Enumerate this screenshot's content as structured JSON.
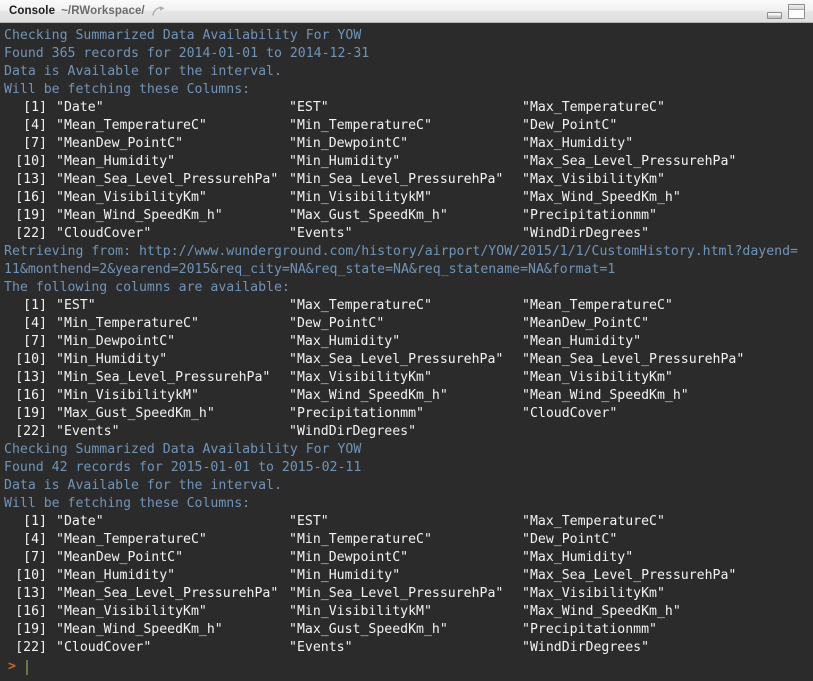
{
  "window": {
    "title": "Console",
    "path": "~/RWorkspace/",
    "icons": {
      "popout": "popout-arrow-icon",
      "minimize": "minimize-icon",
      "maximize": "maximize-icon"
    }
  },
  "colors": {
    "background": "#2b2b2b",
    "info_text": "#7094b8",
    "output_text": "#f2f2f2",
    "prompt": "#c5682a",
    "cursor": "#5f7f42",
    "titlebar": "#ededed"
  },
  "console": {
    "blocks": [
      {
        "type": "info",
        "lines": [
          "Checking Summarized Data Availability For YOW",
          "Found 365 records for 2014-01-01 to 2014-12-31",
          "Data is Available for the interval.",
          "Will be fetching these Columns:"
        ]
      },
      {
        "type": "columns",
        "rows": [
          {
            "index": "[1]",
            "cells": [
              "\"Date\"",
              "\"EST\"",
              "\"Max_TemperatureC\""
            ]
          },
          {
            "index": "[4]",
            "cells": [
              "\"Mean_TemperatureC\"",
              "\"Min_TemperatureC\"",
              "\"Dew_PointC\""
            ]
          },
          {
            "index": "[7]",
            "cells": [
              "\"MeanDew_PointC\"",
              "\"Min_DewpointC\"",
              "\"Max_Humidity\""
            ]
          },
          {
            "index": "[10]",
            "cells": [
              "\"Mean_Humidity\"",
              "\"Min_Humidity\"",
              "\"Max_Sea_Level_PressurehPa\""
            ]
          },
          {
            "index": "[13]",
            "cells": [
              "\"Mean_Sea_Level_PressurehPa\"",
              "\"Min_Sea_Level_PressurehPa\"",
              "\"Max_VisibilityKm\""
            ]
          },
          {
            "index": "[16]",
            "cells": [
              "\"Mean_VisibilityKm\"",
              "\"Min_VisibilitykM\"",
              "\"Max_Wind_SpeedKm_h\""
            ]
          },
          {
            "index": "[19]",
            "cells": [
              "\"Mean_Wind_SpeedKm_h\"",
              "\"Max_Gust_SpeedKm_h\"",
              "\"Precipitationmm\""
            ]
          },
          {
            "index": "[22]",
            "cells": [
              "\"CloudCover\"",
              "\"Events\"",
              "\"WindDirDegrees\""
            ]
          }
        ]
      },
      {
        "type": "info",
        "lines": [
          "Retrieving from: http://www.wunderground.com/history/airport/YOW/2015/1/1/CustomHistory.html?dayend=",
          "11&monthend=2&yearend=2015&req_city=NA&req_state=NA&req_statename=NA&format=1",
          "The following columns are available:"
        ]
      },
      {
        "type": "columns",
        "rows": [
          {
            "index": "[1]",
            "cells": [
              "\"EST\"",
              "\"Max_TemperatureC\"",
              "\"Mean_TemperatureC\""
            ]
          },
          {
            "index": "[4]",
            "cells": [
              "\"Min_TemperatureC\"",
              "\"Dew_PointC\"",
              "\"MeanDew_PointC\""
            ]
          },
          {
            "index": "[7]",
            "cells": [
              "\"Min_DewpointC\"",
              "\"Max_Humidity\"",
              "\"Mean_Humidity\""
            ]
          },
          {
            "index": "[10]",
            "cells": [
              "\"Min_Humidity\"",
              "\"Max_Sea_Level_PressurehPa\"",
              "\"Mean_Sea_Level_PressurehPa\""
            ]
          },
          {
            "index": "[13]",
            "cells": [
              "\"Min_Sea_Level_PressurehPa\"",
              "\"Max_VisibilityKm\"",
              "\"Mean_VisibilityKm\""
            ]
          },
          {
            "index": "[16]",
            "cells": [
              "\"Min_VisibilitykM\"",
              "\"Max_Wind_SpeedKm_h\"",
              "\"Mean_Wind_SpeedKm_h\""
            ]
          },
          {
            "index": "[19]",
            "cells": [
              "\"Max_Gust_SpeedKm_h\"",
              "\"Precipitationmm\"",
              "\"CloudCover\""
            ]
          },
          {
            "index": "[22]",
            "cells": [
              "\"Events\"",
              "\"WindDirDegrees\"",
              ""
            ]
          }
        ]
      },
      {
        "type": "info",
        "lines": [
          "Checking Summarized Data Availability For YOW",
          "Found 42 records for 2015-01-01 to 2015-02-11",
          "Data is Available for the interval.",
          "Will be fetching these Columns:"
        ]
      },
      {
        "type": "columns",
        "rows": [
          {
            "index": "[1]",
            "cells": [
              "\"Date\"",
              "\"EST\"",
              "\"Max_TemperatureC\""
            ]
          },
          {
            "index": "[4]",
            "cells": [
              "\"Mean_TemperatureC\"",
              "\"Min_TemperatureC\"",
              "\"Dew_PointC\""
            ]
          },
          {
            "index": "[7]",
            "cells": [
              "\"MeanDew_PointC\"",
              "\"Min_DewpointC\"",
              "\"Max_Humidity\""
            ]
          },
          {
            "index": "[10]",
            "cells": [
              "\"Mean_Humidity\"",
              "\"Min_Humidity\"",
              "\"Max_Sea_Level_PressurehPa\""
            ]
          },
          {
            "index": "[13]",
            "cells": [
              "\"Mean_Sea_Level_PressurehPa\"",
              "\"Min_Sea_Level_PressurehPa\"",
              "\"Max_VisibilityKm\""
            ]
          },
          {
            "index": "[16]",
            "cells": [
              "\"Mean_VisibilityKm\"",
              "\"Min_VisibilitykM\"",
              "\"Max_Wind_SpeedKm_h\""
            ]
          },
          {
            "index": "[19]",
            "cells": [
              "\"Mean_Wind_SpeedKm_h\"",
              "\"Max_Gust_SpeedKm_h\"",
              "\"Precipitationmm\""
            ]
          },
          {
            "index": "[22]",
            "cells": [
              "\"CloudCover\"",
              "\"Events\"",
              "\"WindDirDegrees\""
            ]
          }
        ]
      }
    ],
    "prompt": {
      "symbol": ">",
      "input": ""
    }
  }
}
